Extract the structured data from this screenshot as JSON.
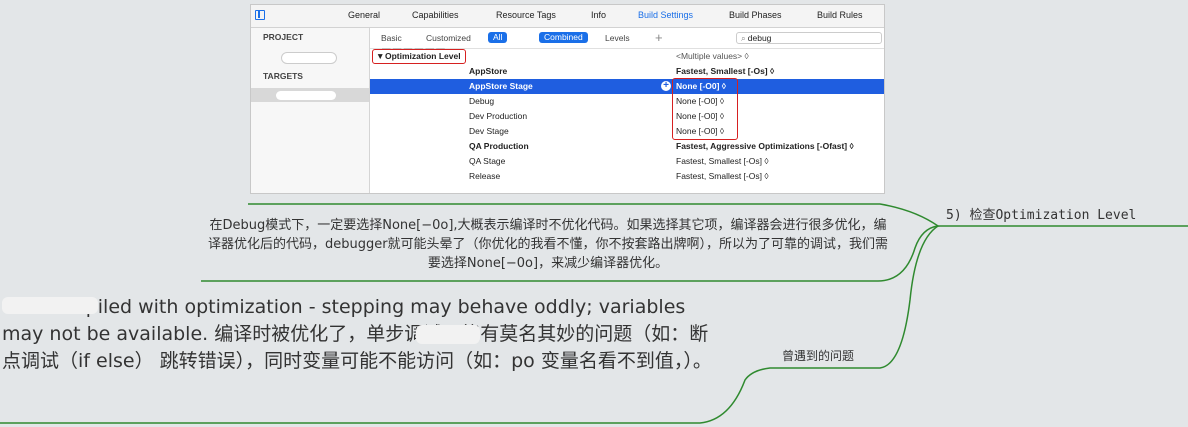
{
  "xcode": {
    "tabs": [
      "General",
      "Capabilities",
      "Resource Tags",
      "Info",
      "Build Settings",
      "Build Phases",
      "Build Rules"
    ],
    "active_tab": "Build Settings",
    "sidebar": {
      "project_header": "PROJECT",
      "targets_header": "TARGETS"
    },
    "filters": {
      "basic": "Basic",
      "customized": "Customized",
      "all": "All",
      "combined": "Combined",
      "levels": "Levels",
      "add": "+"
    },
    "search": {
      "value": "debug",
      "icon": "search-icon"
    },
    "setting_title": "Optimization Level",
    "header_value": "<Multiple values> ◊",
    "rows": [
      {
        "name": "AppStore",
        "value": "Fastest, Smallest [-Os] ◊",
        "bold": true
      },
      {
        "name": "AppStore Stage",
        "value": "None [-O0] ◊",
        "bold": true
      },
      {
        "name": "Debug",
        "value": "None [-O0] ◊",
        "bold": false
      },
      {
        "name": "Dev Production",
        "value": "None [-O0] ◊",
        "bold": false
      },
      {
        "name": "Dev Stage",
        "value": "None [-O0] ◊",
        "bold": false
      },
      {
        "name": "QA Production",
        "value": "Fastest, Aggressive Optimizations [-Ofast] ◊",
        "bold": true
      },
      {
        "name": "QA Stage",
        "value": "Fastest, Smallest [-Os] ◊",
        "bold": false
      },
      {
        "name": "Release",
        "value": "Fastest, Smallest [-Os] ◊",
        "bold": false
      }
    ]
  },
  "mindmap": {
    "topic": "5) 检查Optimization Level",
    "note1": "在Debug模式下，一定要选择None[−0o],大概表示编译时不优化代码。如果选择其它项，编译器会进行很多优化，编译器优化后的代码，debugger就可能头晕了（你优化的我看不懂，你不按套路出牌啊），所以为了可靠的调试，我们需要选择None[−0o]，来减少编译器优化。",
    "issue_label": "曾遇到的问题",
    "note2": "was compiled with optimization - stepping may behave oddly; variables may not be available.       编译时被优化了，单步调试可能有莫名其妙的问题（如：断点调试（if else） 跳转错误），同时变量可能不能访问（如：po 变量名看不到值，）。",
    "line_color": "#2f8a2f"
  }
}
